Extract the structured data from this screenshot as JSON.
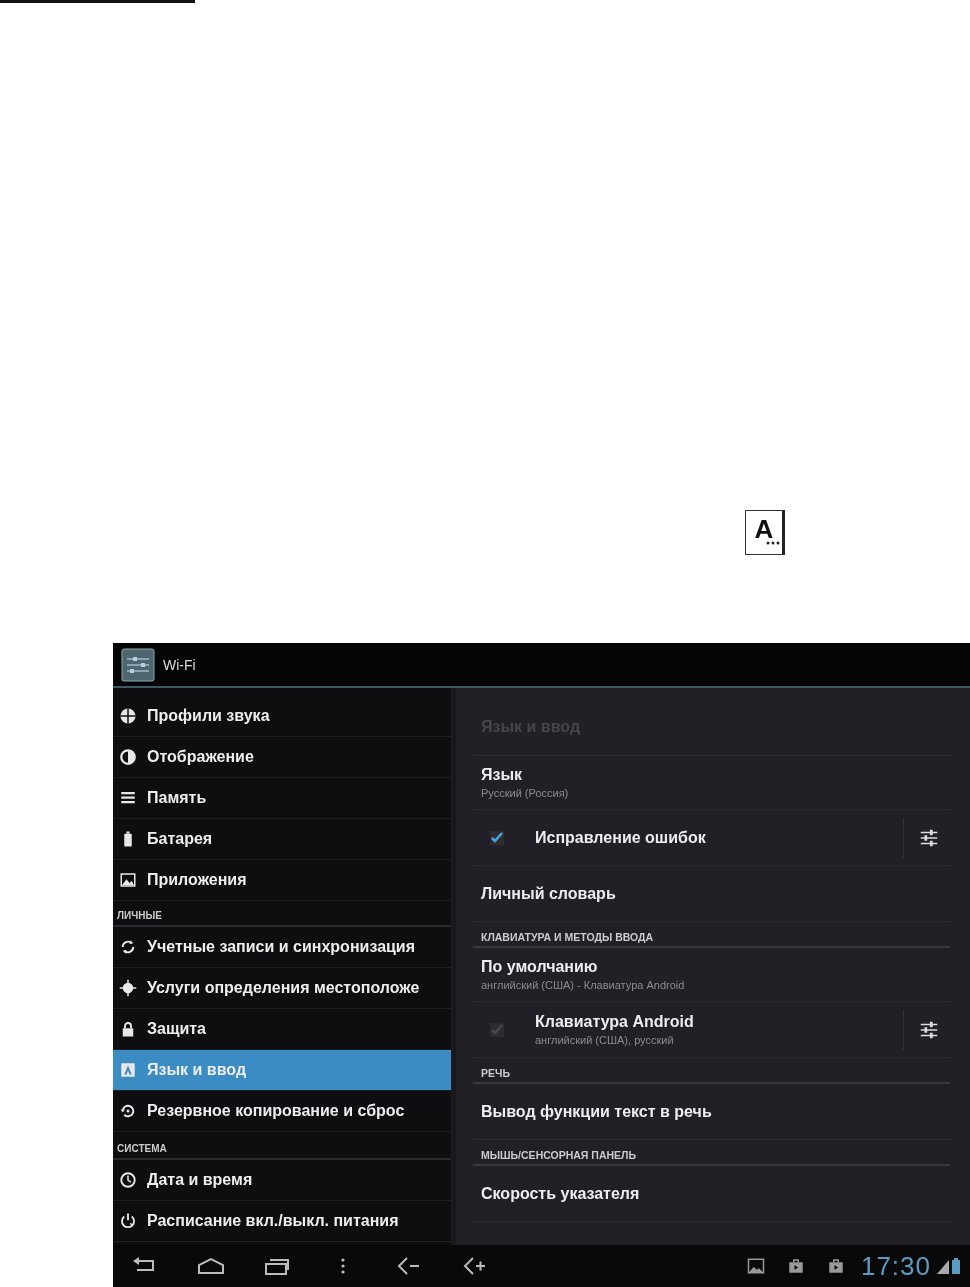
{
  "page": {
    "icon_letter": "A"
  },
  "title_bar": {
    "title": "Wi-Fi"
  },
  "sidebar": {
    "items": [
      {
        "kind": "item",
        "label": "Профили звука",
        "selected": false
      },
      {
        "kind": "item",
        "label": "Отображение",
        "selected": false
      },
      {
        "kind": "item",
        "label": "Память",
        "selected": false
      },
      {
        "kind": "item",
        "label": "Батарея",
        "selected": false
      },
      {
        "kind": "item",
        "label": "Приложения",
        "selected": false
      },
      {
        "kind": "header",
        "label": "ЛИЧНЫЕ"
      },
      {
        "kind": "item",
        "label": "Учетные записи и синхронизация",
        "selected": false
      },
      {
        "kind": "item",
        "label": "Услуги определения местоположе",
        "selected": false
      },
      {
        "kind": "item",
        "label": "Защита",
        "selected": false
      },
      {
        "kind": "item",
        "label": "Язык и ввод",
        "selected": true
      },
      {
        "kind": "item",
        "label": "Резервное копирование и сброс",
        "selected": false
      },
      {
        "kind": "header",
        "label": "СИСТЕМА"
      },
      {
        "kind": "item",
        "label": "Дата и время",
        "selected": false
      },
      {
        "kind": "item",
        "label": "Расписание вкл./выкл. питания",
        "selected": false
      }
    ]
  },
  "detail": {
    "title": "Язык и ввод",
    "items": [
      {
        "kind": "item",
        "title": "Язык",
        "summary": "Русский (Россия)"
      },
      {
        "kind": "checkbox",
        "title": "Исправление ошибок",
        "checked": true,
        "disabled": false
      },
      {
        "kind": "item",
        "title": "Личный словарь"
      },
      {
        "kind": "header",
        "title": "КЛАВИАТУРА И МЕТОДЫ ВВОДА"
      },
      {
        "kind": "item",
        "title": "По умолчанию",
        "summary": "английский (США) - Клавиатура Android"
      },
      {
        "kind": "checkbox",
        "title": "Клавиатура Android",
        "summary": "английский (США), русский",
        "checked": true,
        "disabled": true
      },
      {
        "kind": "header",
        "title": "РЕЧЬ"
      },
      {
        "kind": "item",
        "title": "Вывод функции текст в речь"
      },
      {
        "kind": "header",
        "title": "МЫШЬ/СЕНСОРНАЯ ПАНЕЛЬ"
      },
      {
        "kind": "item",
        "title": "Скорость указателя"
      }
    ]
  },
  "system_bar": {
    "time": "17:30"
  }
}
